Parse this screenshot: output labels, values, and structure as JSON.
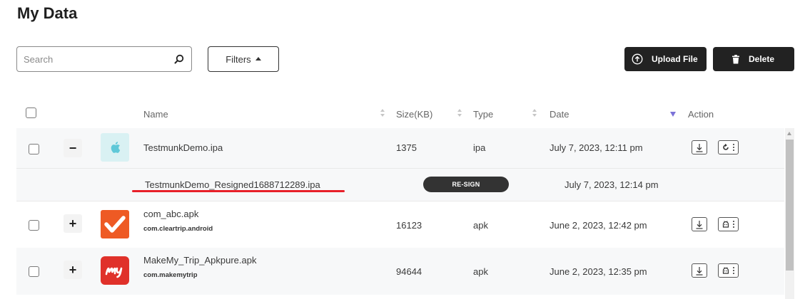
{
  "page": {
    "title": "My Data"
  },
  "toolbar": {
    "search_placeholder": "Search",
    "search_value": "",
    "filters_label": "Filters",
    "upload_label": "Upload File",
    "delete_label": "Delete"
  },
  "table": {
    "columns": {
      "name": "Name",
      "size": "Size(KB)",
      "type": "Type",
      "date": "Date",
      "action": "Action"
    },
    "rows": [
      {
        "expander": "−",
        "name": "TestmunkDemo.ipa",
        "package": "",
        "size": "1375",
        "type": "ipa",
        "date": "July 7, 2023, 12:11 pm",
        "icon": "apple-icon",
        "icon_bg": "#d9f1f3"
      },
      {
        "expander": "+",
        "name": "com_abc.apk",
        "package": "com.cleartrip.android",
        "size": "16123",
        "type": "apk",
        "date": "June 2, 2023, 12:42 pm",
        "icon": "cleartrip-icon",
        "icon_bg": "#ee5a24"
      },
      {
        "expander": "+",
        "name": "MakeMy_Trip_Apkpure.apk",
        "package": "com.makemytrip",
        "size": "94644",
        "type": "apk",
        "date": "June 2, 2023, 12:35 pm",
        "icon": "makemytrip-icon",
        "icon_bg": "#e0312a"
      }
    ],
    "subrow": {
      "name": "TestmunkDemo_Resigned1688712289.ipa",
      "badge": "RE-SIGN",
      "date": "July 7, 2023, 12:14 pm"
    }
  },
  "colors": {
    "dark_button": "#222222",
    "sort_active": "#7b72d8",
    "annotation_underline": "#e8202a"
  }
}
